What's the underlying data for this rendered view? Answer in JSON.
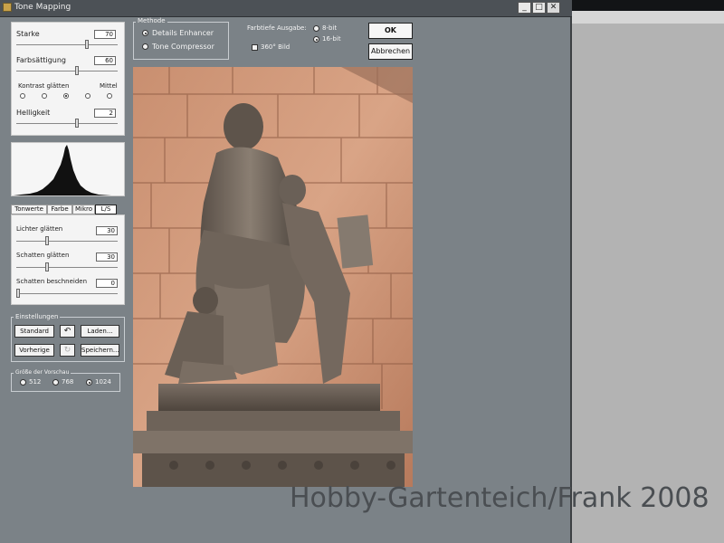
{
  "window": {
    "title": "Tone Mapping",
    "controls": {
      "minimize": "_",
      "maximize": "□",
      "close": "✕"
    }
  },
  "adjust": {
    "starke": {
      "label": "Starke",
      "value": "70",
      "fraction": 0.7
    },
    "farbsaettigung": {
      "label": "Farbsättigung",
      "value": "60",
      "fraction": 0.6
    },
    "kontrast": {
      "label": "Kontrast glätten",
      "mittel": "Mittel",
      "selected_index": 2,
      "count": 5
    },
    "helligkeit": {
      "label": "Helligkeit",
      "value": "2",
      "fraction": 0.6
    }
  },
  "tabs": [
    {
      "label": "Tonwerte"
    },
    {
      "label": "Farbe"
    },
    {
      "label": "Mikro"
    },
    {
      "label": "L/S"
    }
  ],
  "ls": {
    "lichter": {
      "label": "Lichter glätten",
      "value": "30",
      "fraction": 0.3
    },
    "schatten": {
      "label": "Schatten glätten",
      "value": "30",
      "fraction": 0.3
    },
    "beschneiden": {
      "label": "Schatten beschneiden",
      "value": "0",
      "fraction": 0.0
    }
  },
  "einstellungen": {
    "title": "Einstellungen",
    "standard": "Standard",
    "laden": "Laden...",
    "vorherige": "Vorherige",
    "speichern": "Speichern..."
  },
  "vorschau": {
    "title": "Größe der Vorschau",
    "options": [
      "512",
      "768",
      "1024"
    ],
    "selected_index": 2
  },
  "methode": {
    "title": "Methode",
    "options": [
      "Details Enhancer",
      "Tone Compressor"
    ],
    "selected_index": 0
  },
  "farbtiefe": {
    "label": "Farbtiefe Ausgabe:",
    "options": [
      "8-bit",
      "16-bit"
    ],
    "selected_index": 1
  },
  "bild360": {
    "label": "360° Bild",
    "checked": false
  },
  "buttons": {
    "ok": "OK",
    "abbrechen": "Abbrechen"
  },
  "watermark": "Hobby-Gartenteich/Frank 2008",
  "colors": {
    "window_bg": "#7b8287",
    "panel_bg": "#f4f4f4",
    "titlebar": "#4c5156"
  }
}
